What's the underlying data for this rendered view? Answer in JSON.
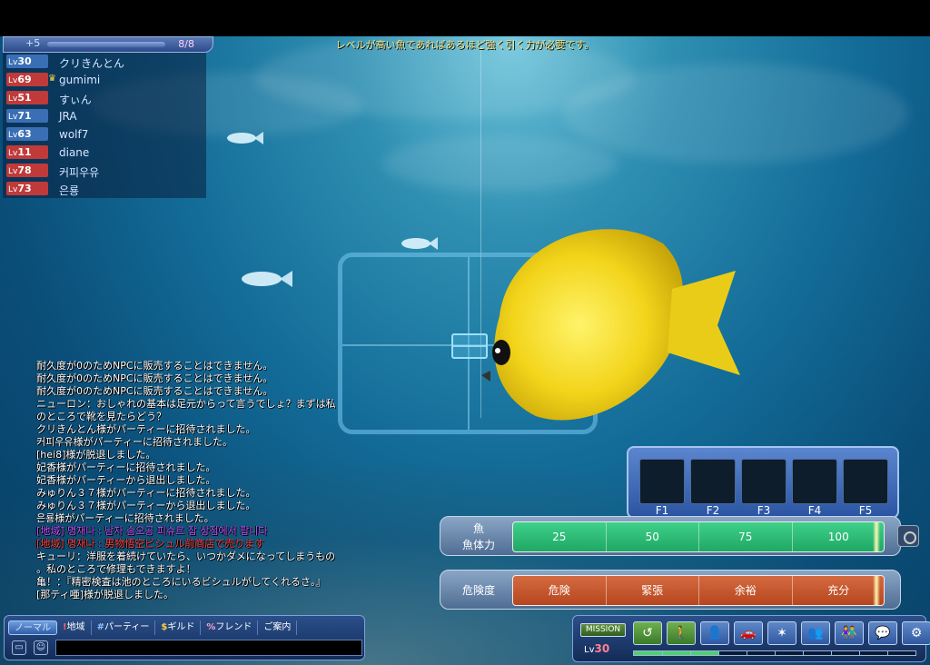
{
  "top_message": "レベルが高い魚であればあるほど強く引く力が必要です。",
  "party": {
    "plus": "+5",
    "count": "8/8",
    "members": [
      {
        "lv": "30",
        "name": "クリきんとん",
        "leader": false,
        "color": "#3a6fb5"
      },
      {
        "lv": "69",
        "name": "gumimi",
        "leader": true,
        "color": "#c03a3a"
      },
      {
        "lv": "51",
        "name": "すぃん",
        "leader": false,
        "color": "#c03a3a"
      },
      {
        "lv": "71",
        "name": "JRA",
        "leader": false,
        "color": "#3a6fb5"
      },
      {
        "lv": "63",
        "name": "wolf7",
        "leader": false,
        "color": "#3a6fb5"
      },
      {
        "lv": "11",
        "name": "diane",
        "leader": false,
        "color": "#c03a3a"
      },
      {
        "lv": "78",
        "name": "커피우유",
        "leader": false,
        "color": "#c03a3a"
      },
      {
        "lv": "73",
        "name": "은룡",
        "leader": false,
        "color": "#c03a3a"
      }
    ],
    "lv_prefix": "Lv",
    "leader_icon": "crown-icon"
  },
  "chat": {
    "lines": [
      {
        "text": "耐久度が0のためNPCに販売することはできません。",
        "kind": "sys"
      },
      {
        "text": "耐久度が0のためNPCに販売することはできません。",
        "kind": "sys"
      },
      {
        "text": "耐久度が0のためNPCに販売することはできません。",
        "kind": "sys"
      },
      {
        "text": "ニューロン：おしゃれの基本は足元からって言うでしょ？まずは私",
        "kind": "sys"
      },
      {
        "text": "のところで靴を見たらどう？",
        "kind": "sys"
      },
      {
        "text": "クリきんとん様がパーティーに招待されました。",
        "kind": "sys"
      },
      {
        "text": "커피우유様がパーティーに招待されました。",
        "kind": "sys"
      },
      {
        "text": "[hei8]様が脱退しました。",
        "kind": "sys"
      },
      {
        "text": "妃香様がパーティーに招待されました。",
        "kind": "sys"
      },
      {
        "text": "妃香様がパーティーから退出しました。",
        "kind": "sys"
      },
      {
        "text": "みゅりん３７様がパーティーに招待されました。",
        "kind": "sys"
      },
      {
        "text": "みゅりん３７様がパーティーから退出しました。",
        "kind": "sys"
      },
      {
        "text": "은룡様がパーティーに招待されました。",
        "kind": "sys"
      },
      {
        "text": "[地域] 명재나 : 남자 솜오공 피슈르 잡 상점에서 팝니다",
        "kind": "purple"
      },
      {
        "text": "[地域] 명재나 : 男物悟空ビシュル前商店で売ります",
        "kind": "red"
      },
      {
        "text": "キューリ：洋服を着続けていたら、いつかダメになってしまうもの",
        "kind": "sys"
      },
      {
        "text": "。私のところで修理もできますよ！",
        "kind": "sys"
      },
      {
        "text": "亀！：『精密検査は池のところにいるビシュルがしてくれるさ。』",
        "kind": "sys"
      },
      {
        "text": "[那ティ唖]様が脱退しました。",
        "kind": "sys"
      }
    ],
    "tabs": [
      {
        "key": "",
        "label": "ノーマル",
        "style": "active"
      },
      {
        "key": "!",
        "label": "地域",
        "style": "tab-red"
      },
      {
        "key": "#",
        "label": "パーティー",
        "style": "tab-blue"
      },
      {
        "key": "$",
        "label": "ギルド",
        "style": "tab-yellow"
      },
      {
        "key": "%",
        "label": "フレンド",
        "style": "tab-pink"
      },
      {
        "key": "",
        "label": "ご案内",
        "style": ""
      }
    ],
    "input_value": ""
  },
  "fkeys": [
    "F1",
    "F2",
    "F3",
    "F4",
    "F5"
  ],
  "fish_meter": {
    "label_line1": "魚",
    "label_line2": "魚体力",
    "ticks": [
      "25",
      "50",
      "75",
      "100"
    ],
    "level": 0.98
  },
  "danger_meter": {
    "label": "危険度",
    "ticks": [
      "危険",
      "緊張",
      "余裕",
      "充分"
    ],
    "level": 0.98
  },
  "menu": {
    "mission_label": "MISSION",
    "lv_prefix": "Lv",
    "lv_value": "30",
    "xp_progress": 0.3,
    "buttons": [
      "return-icon",
      "character-icon",
      "profile-icon",
      "vehicle-icon",
      "skill-icon",
      "party-add-icon",
      "community-icon",
      "chat-bubble-icon",
      "gear-icon"
    ]
  },
  "colors": {
    "fish_bar": "#1ea864",
    "danger_bar": "#b6461f",
    "panel_blue": "#2b55a2",
    "water": "#136c98"
  }
}
